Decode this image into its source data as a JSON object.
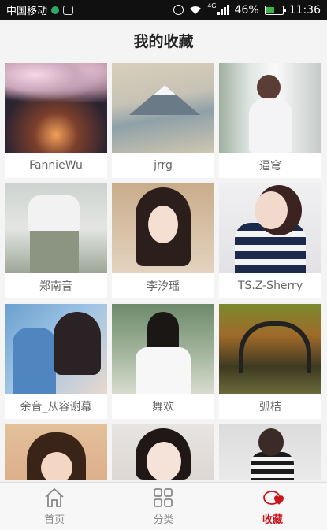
{
  "status_bar": {
    "carrier": "中国移动",
    "network": "4G",
    "battery": "46%",
    "time": "11:36"
  },
  "header": {
    "title": "我的收藏"
  },
  "favorites": [
    {
      "name": "FannieWu"
    },
    {
      "name": "jrrg"
    },
    {
      "name": "逼穹"
    },
    {
      "name": "郑南音"
    },
    {
      "name": "李汐瑶"
    },
    {
      "name": "TS.Z-Sherry"
    },
    {
      "name": "余音_从容谢幕"
    },
    {
      "name": "舞欢"
    },
    {
      "name": "弧桔"
    },
    {
      "name": ""
    },
    {
      "name": ""
    },
    {
      "name": ""
    }
  ],
  "tabbar": {
    "home_label": "首页",
    "category_label": "分类",
    "favorites_label": "收藏",
    "active_tab": "收藏",
    "active_color": "#c8161d"
  }
}
